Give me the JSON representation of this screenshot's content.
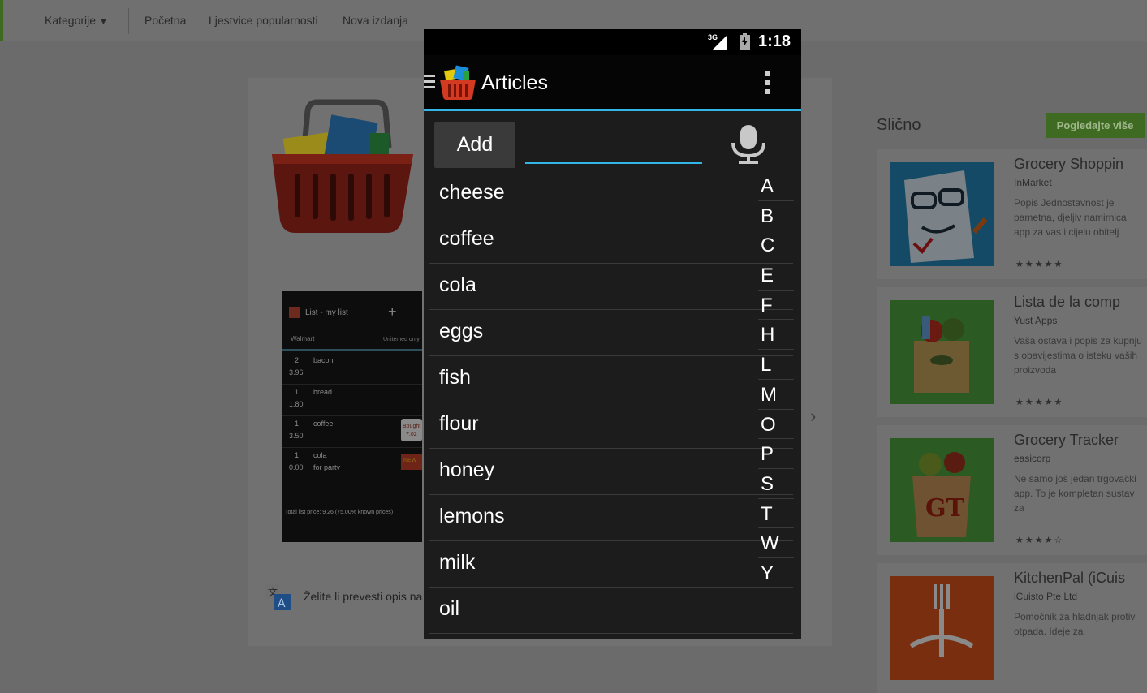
{
  "store": {
    "nav": {
      "categories": "Kategorije",
      "home": "Početna",
      "charts": "Ljestvice popularnosti",
      "new_releases": "Nova izdanja"
    },
    "translate_text": "Želite li prevesti opis na",
    "similar_title": "Slično",
    "see_more": "Pogledajte više",
    "similar_apps": [
      {
        "name": "Grocery Shoppin",
        "developer": "InMarket",
        "description": "Popis Jednostavnost je pametna, djeljiv namirnica app za vas i cijelu obitelj",
        "stars": "★★★★★"
      },
      {
        "name": "Lista de la comp",
        "developer": "Yust Apps",
        "description": "Vaša ostava i popis za kupnju s obavijestima o isteku vaših proizvoda",
        "stars": "★★★★★"
      },
      {
        "name": "Grocery Tracker",
        "developer": "easicorp",
        "description": "Ne samo još jedan trgovački app. To je kompletan sustav za",
        "stars": "★★★★☆"
      },
      {
        "name": "KitchenPal (iCuis",
        "developer": "iCuisto Pte Ltd",
        "description": "Pomoćnik za hladnjak protiv otpada. Ideje za",
        "stars": ""
      }
    ],
    "screenshot": {
      "title": "List - my list",
      "store": "Walmart",
      "filter": "Unitemed only",
      "rows": [
        {
          "qty": "2",
          "price": "3.96",
          "name": "bacon",
          "note": ""
        },
        {
          "qty": "1",
          "price": "1.80",
          "name": "bread",
          "note": ""
        },
        {
          "qty": "1",
          "price": "3.50",
          "name": "coffee",
          "note": ""
        },
        {
          "qty": "1",
          "price": "0.00",
          "name": "cola",
          "note": "for party"
        }
      ],
      "bought_label": "Bought",
      "bought_value": "7.02",
      "new_badge": "NEW",
      "total": "Total list price: 9.26 (75.00% known prices)"
    }
  },
  "phone": {
    "status": {
      "network": "3G",
      "time": "1:18"
    },
    "title": "Articles",
    "add_label": "Add",
    "input_value": "",
    "articles": [
      "cheese",
      "coffee",
      "cola",
      "eggs",
      "fish",
      "flour",
      "honey",
      "lemons",
      "milk",
      "oil"
    ],
    "index_letters": [
      "A",
      "B",
      "C",
      "E",
      "F",
      "H",
      "L",
      "M",
      "O",
      "P",
      "S",
      "T",
      "W",
      "Y"
    ]
  },
  "colors": {
    "accent": "#33b5e5",
    "store_green": "#3e6a22"
  }
}
